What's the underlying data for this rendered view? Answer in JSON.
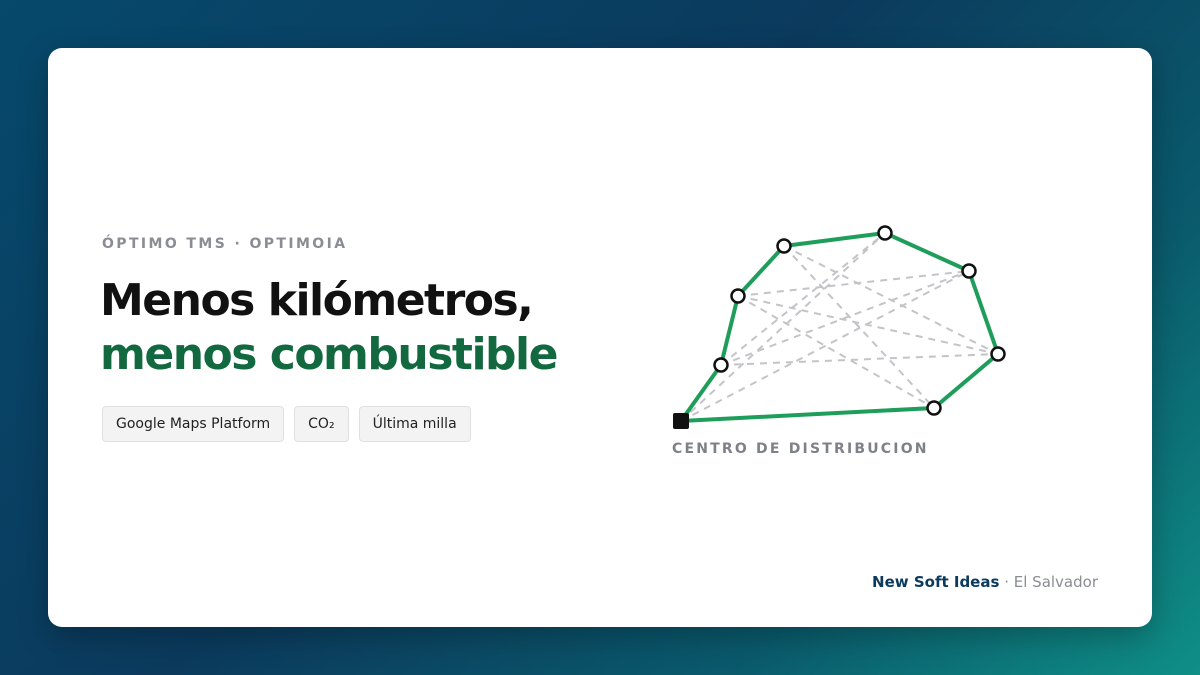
{
  "eyebrow": "ÓPTIMO TMS · OPTIMOIA",
  "headline": {
    "line1": "Menos kilómetros,",
    "line2": "menos combustible"
  },
  "chips": [
    "Google Maps Platform",
    "CO₂",
    "Última milla"
  ],
  "diagram": {
    "depot_label": "CENTRO DE DISTRIBUCION",
    "route_color": "#1f9d5b",
    "alt_color": "#c4c4c8"
  },
  "footer": {
    "brand": "New Soft Ideas",
    "separator": "·",
    "place": "El Salvador"
  },
  "colors": {
    "accent": "#13693f",
    "brand": "#0b3a5d",
    "muted": "#8a8d93"
  }
}
